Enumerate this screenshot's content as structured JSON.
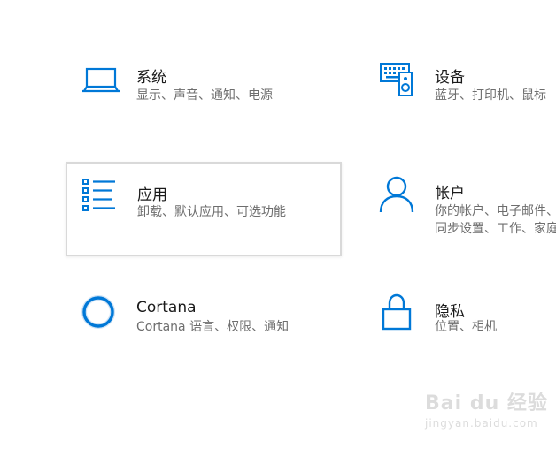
{
  "accent_color": "#0078d7",
  "tiles": [
    {
      "id": "system",
      "title": "系统",
      "desc": "显示、声音、通知、电源",
      "icon": "laptop-icon"
    },
    {
      "id": "devices",
      "title": "设备",
      "desc": "蓝牙、打印机、鼠标",
      "icon": "keyboard-speaker-icon"
    },
    {
      "id": "apps",
      "title": "应用",
      "desc": "卸载、默认应用、可选功能",
      "icon": "app-list-icon"
    },
    {
      "id": "accounts",
      "title": "帐户",
      "desc": "你的帐户、电子邮件、同步设置、工作、家庭",
      "icon": "person-icon"
    },
    {
      "id": "cortana",
      "title": "Cortana",
      "desc": "Cortana 语言、权限、通知",
      "icon": "cortana-circle-icon"
    },
    {
      "id": "privacy",
      "title": "隐私",
      "desc": "位置、相机",
      "icon": "lock-icon"
    }
  ],
  "watermark": {
    "line1": "Bai du 经验",
    "line2": "jingyan.baidu.com"
  }
}
